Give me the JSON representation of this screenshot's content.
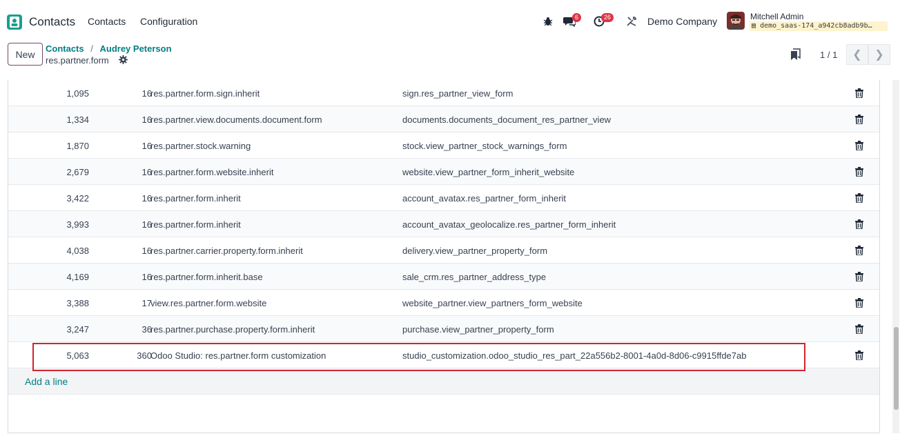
{
  "header": {
    "app_name": "Contacts",
    "menu": [
      "Contacts",
      "Configuration"
    ],
    "messages_count": "6",
    "activities_count": "26",
    "company": "Demo Company",
    "user_name": "Mitchell Admin",
    "database": "demo_saas-174_a942cb8adb9b…"
  },
  "control": {
    "new_label": "New",
    "breadcrumb_parent": "Contacts",
    "breadcrumb_sep": "/",
    "breadcrumb_current": "Audrey Peterson",
    "model": "res.partner.form",
    "pager": "1 / 1"
  },
  "rows": [
    {
      "id": "1,095",
      "priority": "16",
      "name": "res.partner.form.sign.inherit",
      "xml_id": "sign.res_partner_view_form"
    },
    {
      "id": "1,334",
      "priority": "16",
      "name": "res.partner.view.documents.document.form",
      "xml_id": "documents.documents_document_res_partner_view"
    },
    {
      "id": "1,870",
      "priority": "16",
      "name": "res.partner.stock.warning",
      "xml_id": "stock.view_partner_stock_warnings_form"
    },
    {
      "id": "2,679",
      "priority": "16",
      "name": "res.partner.form.website.inherit",
      "xml_id": "website.view_partner_form_inherit_website"
    },
    {
      "id": "3,422",
      "priority": "16",
      "name": "res.partner.form.inherit",
      "xml_id": "account_avatax.res_partner_form_inherit"
    },
    {
      "id": "3,993",
      "priority": "16",
      "name": "res.partner.form.inherit",
      "xml_id": "account_avatax_geolocalize.res_partner_form_inherit"
    },
    {
      "id": "4,038",
      "priority": "16",
      "name": "res.partner.carrier.property.form.inherit",
      "xml_id": "delivery.view_partner_property_form"
    },
    {
      "id": "4,169",
      "priority": "16",
      "name": "res.partner.form.inherit.base",
      "xml_id": "sale_crm.res_partner_address_type"
    },
    {
      "id": "3,388",
      "priority": "17",
      "name": "view.res.partner.form.website",
      "xml_id": "website_partner.view_partners_form_website"
    },
    {
      "id": "3,247",
      "priority": "36",
      "name": "res.partner.purchase.property.form.inherit",
      "xml_id": "purchase.view_partner_property_form"
    },
    {
      "id": "5,063",
      "priority": "360",
      "name": "Odoo Studio: res.partner.form customization",
      "xml_id": "studio_customization.odoo_studio_res_part_22a556b2-8001-4a0d-8d06-c9915ffde7ab"
    }
  ],
  "add_line_label": "Add a line",
  "colors": {
    "accent": "#017e84",
    "brand": "#714b67",
    "badge": "#dc3545",
    "highlight": "#d1222d"
  }
}
